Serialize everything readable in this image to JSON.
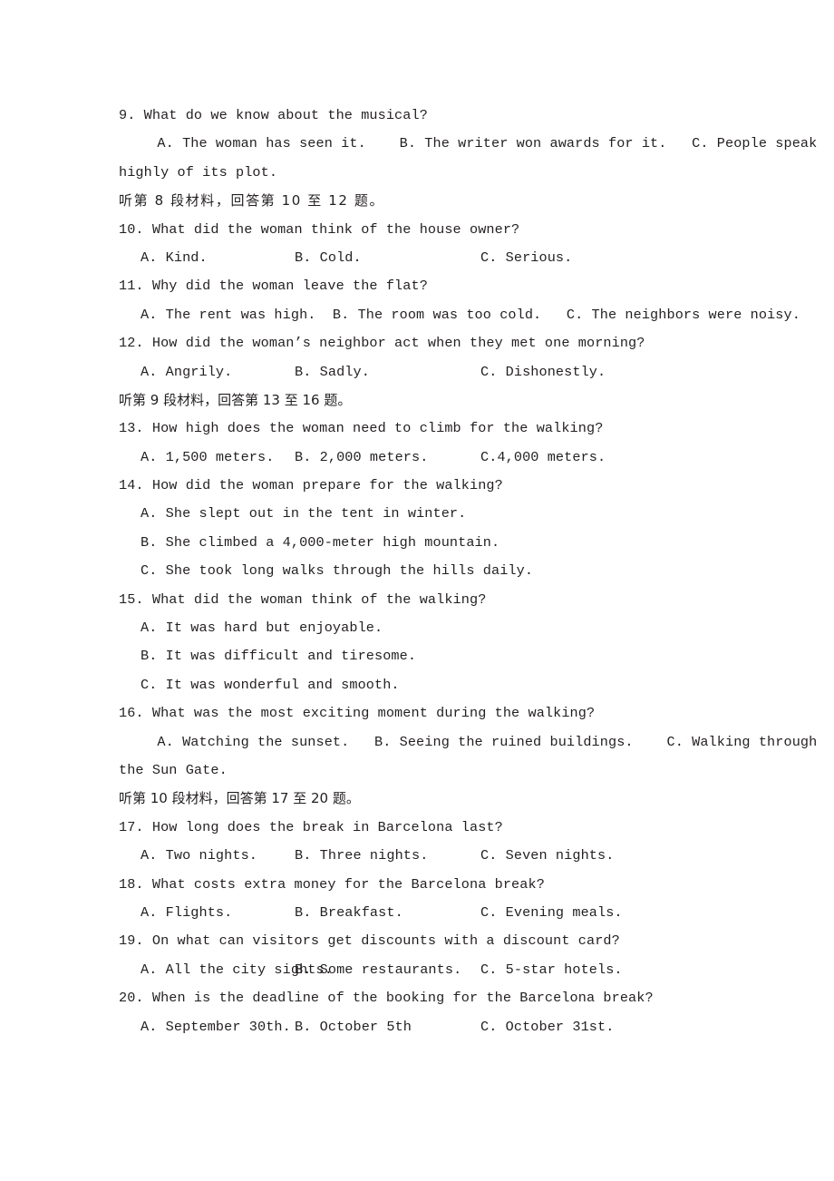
{
  "document": {
    "type": "exam-paper-listening-section",
    "page_background": "#ffffff",
    "text_color": "#231f20"
  },
  "blocks": [
    {
      "kind": "question",
      "name": "question-9",
      "stem": "9. What do we know about the musical?",
      "layout": "inline",
      "option_rows": [
        "  A. The woman has seen it.    B. The writer won awards for it.   C. People speak",
        "highly of its plot."
      ]
    },
    {
      "kind": "section-header",
      "name": "section-header-8",
      "text": "听第 8 段材料，回答第 10 至 12 题。",
      "spaced": true
    },
    {
      "kind": "question",
      "name": "question-10",
      "stem": "10. What did the woman think of the house owner?",
      "layout": "columns",
      "options": [
        "A. Kind.",
        "B. Cold.",
        "C. Serious."
      ]
    },
    {
      "kind": "question",
      "name": "question-11",
      "stem": "11. Why did the woman leave the flat?",
      "layout": "inline",
      "option_rows": [
        "A. The rent was high.  B. The room was too cold.   C. The neighbors were noisy."
      ]
    },
    {
      "kind": "question",
      "name": "question-12",
      "stem": "12. How did the woman’s neighbor act when they met one morning?",
      "layout": "columns",
      "options": [
        "A. Angrily.",
        "B. Sadly.",
        "C. Dishonestly."
      ]
    },
    {
      "kind": "section-header",
      "name": "section-header-9",
      "text": "听第 9 段材料，回答第 13 至 16 题。",
      "spaced": false
    },
    {
      "kind": "question",
      "name": "question-13",
      "stem": "13. How high does the woman need to climb for the walking?",
      "layout": "columns",
      "options": [
        "A. 1,500 meters.",
        "B. 2,000 meters.",
        "C.4,000 meters."
      ]
    },
    {
      "kind": "question",
      "name": "question-14",
      "stem": "14. How did the woman prepare for the walking?",
      "layout": "stacked",
      "options": [
        "A. She slept out in the tent in winter.",
        "B. She climbed a 4,000-meter high mountain.",
        "C. She took long walks through the hills daily."
      ]
    },
    {
      "kind": "question",
      "name": "question-15",
      "stem": "15. What did the woman think of the walking?",
      "layout": "stacked",
      "options": [
        "A. It was hard but enjoyable.",
        "B. It was difficult and tiresome.",
        "C. It was wonderful and smooth."
      ]
    },
    {
      "kind": "question",
      "name": "question-16",
      "stem": "16. What was the most exciting moment during the walking?",
      "layout": "inline",
      "option_rows": [
        "  A. Watching the sunset.   B. Seeing the ruined buildings.    C. Walking through",
        "the Sun Gate."
      ]
    },
    {
      "kind": "section-header",
      "name": "section-header-10",
      "text": "听第 10 段材料，回答第 17 至 20 题。",
      "spaced": false
    },
    {
      "kind": "question",
      "name": "question-17",
      "stem": "17. How long does the break in Barcelona last?",
      "layout": "columns",
      "options": [
        "A. Two nights.",
        "B. Three nights.",
        "C. Seven nights."
      ]
    },
    {
      "kind": "question",
      "name": "question-18",
      "stem": "18. What costs extra money for the Barcelona break?",
      "layout": "columns",
      "options": [
        "A. Flights.",
        "B. Breakfast.",
        "C. Evening meals."
      ]
    },
    {
      "kind": "question",
      "name": "question-19",
      "stem": "19. On what can visitors get discounts with a discount card?",
      "layout": "columns",
      "options": [
        "A. All the city sights.",
        "B. Some restaurants.",
        "C. 5-star hotels."
      ]
    },
    {
      "kind": "question",
      "name": "question-20",
      "stem": "20. When is the deadline of the booking for the Barcelona break?",
      "layout": "columns",
      "options": [
        "A. September 30th.",
        "B. October 5th",
        "C. October 31st."
      ]
    }
  ]
}
